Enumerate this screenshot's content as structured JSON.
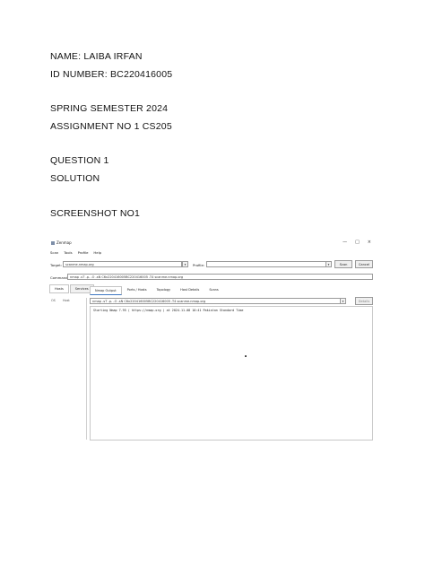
{
  "doc": {
    "name_line": "NAME: LAIBA IRFAN",
    "id_line": "ID NUMBER: BC220416005",
    "semester_line": "SPRING SEMESTER 2024",
    "assignment_line": "ASSIGNMENT NO 1 CS205",
    "question_line": "QUESTION 1",
    "solution_line": "SOLUTION",
    "screenshot_line": "SCREENSHOT NO1"
  },
  "app": {
    "title": "Zenmap",
    "window_buttons": [
      "—",
      "□",
      "×"
    ],
    "menu": [
      "Scan",
      "Tools",
      "Profile",
      "Help"
    ],
    "target_label": "Target:",
    "target_value": "scanme.nmap.org",
    "profile_label": "Profile:",
    "profile_value": "",
    "scan_button": "Scan",
    "cancel_button": "Cancel",
    "command_label": "Command:",
    "command_value": "nmap -sT -p- -O -sN C6x220416005BC220416005 -T4 scanme.nmap.org",
    "left_tabs": [
      "Hosts",
      "Services"
    ],
    "left_os_label": "OS",
    "left_host_label": "Host",
    "right_tabs": [
      "Nmap Output",
      "Ports / Hosts",
      "Topology",
      "Host Details",
      "Scans"
    ],
    "output_select": "nmap -sT -p- -O -sN C6x220416005BC220416005 -T4 scanme.nmap.org",
    "details_button": "Details",
    "output_text": "Starting Nmap 7.95 ( https://nmap.org ) at 2024-11-08 10:41 Pakistan Standard Time"
  }
}
